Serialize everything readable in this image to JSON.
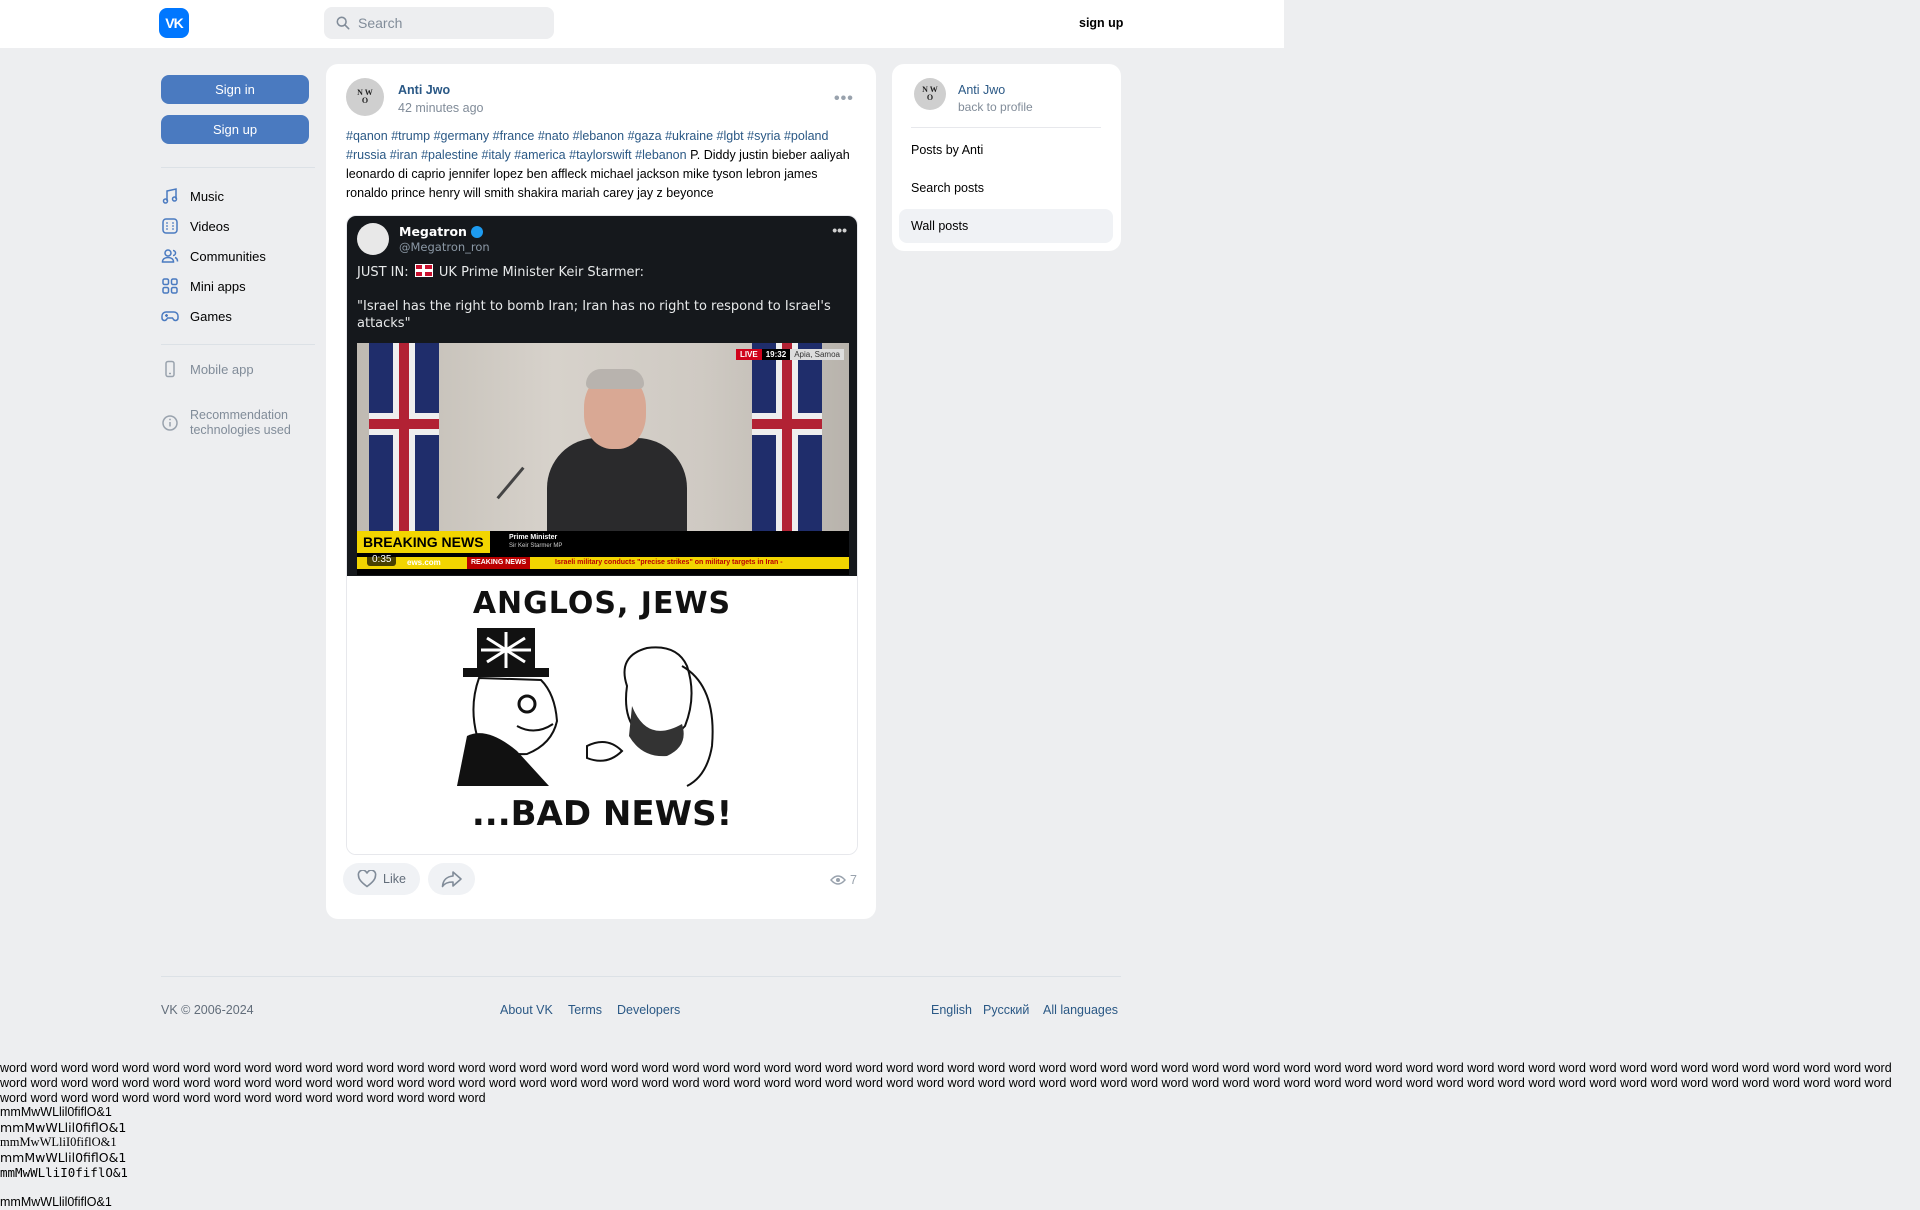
{
  "header": {
    "logo_text": "VK",
    "search_placeholder": "Search",
    "signup_label": "sign up"
  },
  "sidebar": {
    "signin_label": "Sign in",
    "signup_label": "Sign up",
    "items": [
      {
        "label": "Music",
        "icon": "music-icon"
      },
      {
        "label": "Videos",
        "icon": "videos-icon"
      },
      {
        "label": "Communities",
        "icon": "communities-icon"
      },
      {
        "label": "Mini apps",
        "icon": "mini-apps-icon"
      },
      {
        "label": "Games",
        "icon": "games-icon"
      }
    ],
    "mobile_app_label": "Mobile app",
    "recommendation_line1": "Recommendation",
    "recommendation_line2": "technologies used"
  },
  "post": {
    "author": "Anti Jwo",
    "time": "42 minutes ago",
    "hashtags": [
      "#qanon",
      "#trump",
      "#germany",
      "#france",
      "#nato",
      "#lebanon",
      "#gaza",
      "#ukraine",
      "#lgbt",
      "#syria",
      "#poland",
      "#russia",
      "#iran",
      "#palestine",
      "#italy",
      "#america",
      "#taylorswift",
      "#lebanon"
    ],
    "text": "P. Diddy justin bieber aaliyah leonardo di caprio jennifer lopez ben affleck michael jackson mike tyson lebron james ronaldo prince henry will smith shakira mariah carey jay z beyonce",
    "like_label": "Like",
    "views": "7",
    "image": {
      "tweet_name": "Megatron",
      "tweet_handle": "@Megatron_ron",
      "tweet_line_prefix": "JUST IN:",
      "tweet_line_suffix": "UK Prime Minister Keir Starmer:",
      "tweet_quote": "\"Israel has the right to bomb Iran; Iran has no right to respond to Israel's attacks\"",
      "live": "LIVE",
      "clock": "19:32",
      "location": "Apia, Samoa",
      "breaking": "BREAKING NEWS",
      "pm_title": "Prime Minister",
      "pm_name": "Sir Keir Starmer MP",
      "duration": "0:35",
      "source": "ews.com",
      "ticker_label": "REAKING NEWS",
      "ticker_text": "Israeli military conducts \"precise strikes\" on military targets in Iran -",
      "cartoon_title": "ANGLOS, JEWS",
      "cartoon_bottom": "...BAD NEWS!"
    }
  },
  "right_panel": {
    "name": "Anti Jwo",
    "back": "back to profile",
    "items": [
      {
        "label": "Posts by Anti",
        "active": false
      },
      {
        "label": "Search posts",
        "active": false
      },
      {
        "label": "Wall posts",
        "active": true
      }
    ]
  },
  "footer": {
    "copyright": "VK © 2006-2024",
    "about": "About VK",
    "terms": "Terms",
    "developers": "Developers",
    "english": "English",
    "russian": "Русский",
    "all_languages": "All languages"
  },
  "test_text": {
    "words": "word word word word word word word word word word word word word word word word word word word word word word word word word word word word word word word word word word word word word word word word word word word word word word word word word word word word word word word word word word word word word word word word word word word word word word word word word word word word word word word word word word word word word word word word word word word word word word word word word word word word word word word word word word word word word word word word word word word word word word word word word word word word word word word word word word word word word word word word word word word word",
    "font_lines": [
      "mmMwWLlil0fiflO&1",
      "mmMwWLlil0fiflO&1",
      "mmMwWLliI0fiflO&1",
      "mmMwWLlil0fiflO&1",
      "mmMwWLliI0fiflO&1",
      "mmMwWLlil0fiflO&1"
    ]
  }
}
